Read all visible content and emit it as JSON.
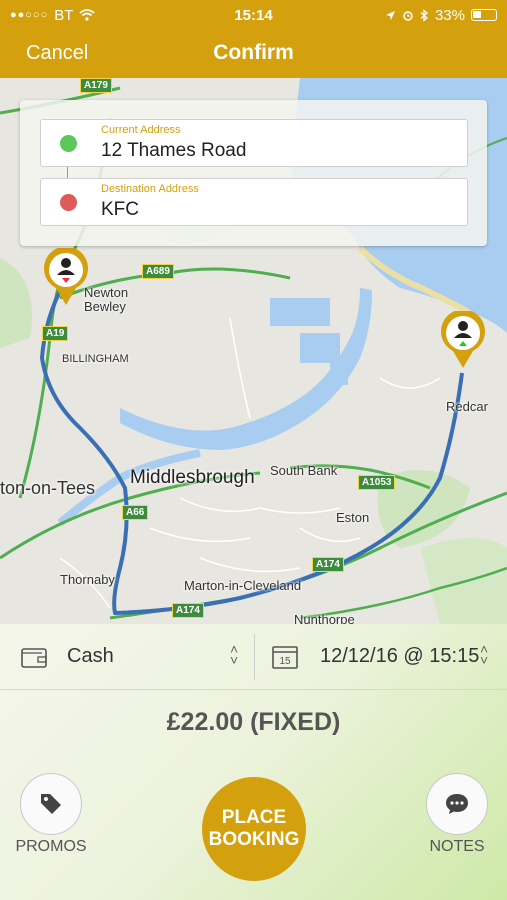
{
  "status_bar": {
    "carrier": "BT",
    "signal": "●●○○○",
    "time": "15:14",
    "battery": "33%"
  },
  "nav": {
    "cancel_label": "Cancel",
    "title": "Confirm"
  },
  "addresses": {
    "current": {
      "label": "Current Address",
      "value": "12 Thames Road",
      "color": "#5cc85c"
    },
    "destination": {
      "label": "Destination Address",
      "value": "KFC",
      "color": "#e05a5a"
    }
  },
  "map": {
    "places": {
      "newton_bewley": "Newton\nBewley",
      "billingham": "BILLINGHAM",
      "middlesbrough": "Middlesbrough",
      "south_bank": "South Bank",
      "redcar": "Redcar",
      "stockton": "ton-on-Tees",
      "eston": "Eston",
      "thornaby": "Thornaby",
      "marton": "Marton-in-Cleveland",
      "nunthorpe": "Nunthorpe"
    },
    "roads": {
      "a179": "A179",
      "a689": "A689",
      "a19": "A19",
      "a66": "A66",
      "a1053": "A1053",
      "a174_east": "A174",
      "a174_west": "A174"
    },
    "colors": {
      "route": "#3a6fb5",
      "road": "#4fae4f",
      "sea": "#a9cdf0",
      "land": "#e8e6e0"
    }
  },
  "payment": {
    "method": "Cash",
    "icon": "wallet-icon"
  },
  "schedule": {
    "datetime": "12/12/16 @ 15:15",
    "icon": "calendar-icon",
    "calendar_day": "15"
  },
  "price": "£22.00 (FIXED)",
  "actions": {
    "promos_label": "PROMOS",
    "place_booking_label": "PLACE\nBOOKING",
    "notes_label": "NOTES"
  },
  "theme": {
    "accent": "#d4a00e"
  }
}
